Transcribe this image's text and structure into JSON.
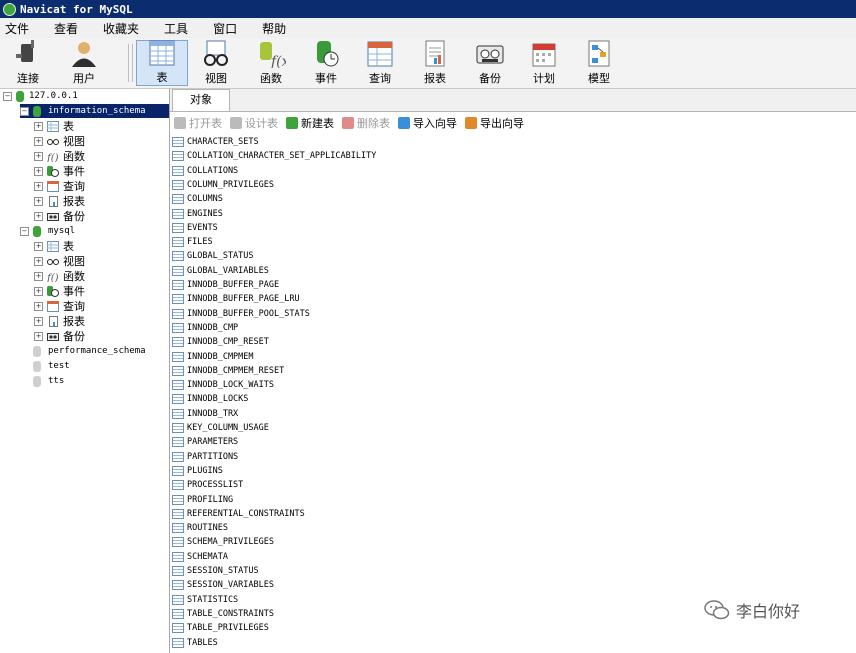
{
  "window": {
    "title": "Navicat for MySQL"
  },
  "menu": [
    "文件",
    "查看",
    "收藏夹",
    "工具",
    "窗口",
    "帮助"
  ],
  "toolbar": [
    {
      "label": "连接",
      "icon": "plug-icon"
    },
    {
      "label": "用户",
      "icon": "user-icon"
    },
    {
      "label": "表",
      "icon": "table-icon",
      "active": true
    },
    {
      "label": "视图",
      "icon": "glasses-icon"
    },
    {
      "label": "函数",
      "icon": "function-icon"
    },
    {
      "label": "事件",
      "icon": "event-clock-icon"
    },
    {
      "label": "查询",
      "icon": "query-icon"
    },
    {
      "label": "报表",
      "icon": "report-icon"
    },
    {
      "label": "备份",
      "icon": "backup-tape-icon"
    },
    {
      "label": "计划",
      "icon": "calendar-icon"
    },
    {
      "label": "模型",
      "icon": "model-icon"
    }
  ],
  "tree": {
    "connection": "127.0.0.1",
    "databases": [
      {
        "name": "information_schema",
        "selected": true,
        "expanded": true,
        "children": [
          "表",
          "视图",
          "函数",
          "事件",
          "查询",
          "报表",
          "备份"
        ]
      },
      {
        "name": "mysql",
        "expanded": true,
        "children": [
          "表",
          "视图",
          "函数",
          "事件",
          "查询",
          "报表",
          "备份"
        ]
      },
      {
        "name": "performance_schema"
      },
      {
        "name": "test"
      },
      {
        "name": "tts"
      }
    ]
  },
  "tabs": [
    "对象"
  ],
  "actions": [
    {
      "label": "打开表",
      "enabled": false,
      "color": "#bbbbbb"
    },
    {
      "label": "设计表",
      "enabled": false,
      "color": "#bbbbbb"
    },
    {
      "label": "新建表",
      "enabled": true,
      "color": "#3da33b"
    },
    {
      "label": "删除表",
      "enabled": false,
      "color": "#e08a8a"
    },
    {
      "label": "导入向导",
      "enabled": true,
      "color": "#3a8fd9"
    },
    {
      "label": "导出向导",
      "enabled": true,
      "color": "#e0892a"
    }
  ],
  "tables": [
    "CHARACTER_SETS",
    "COLLATION_CHARACTER_SET_APPLICABILITY",
    "COLLATIONS",
    "COLUMN_PRIVILEGES",
    "COLUMNS",
    "ENGINES",
    "EVENTS",
    "FILES",
    "GLOBAL_STATUS",
    "GLOBAL_VARIABLES",
    "INNODB_BUFFER_PAGE",
    "INNODB_BUFFER_PAGE_LRU",
    "INNODB_BUFFER_POOL_STATS",
    "INNODB_CMP",
    "INNODB_CMP_RESET",
    "INNODB_CMPMEM",
    "INNODB_CMPMEM_RESET",
    "INNODB_LOCK_WAITS",
    "INNODB_LOCKS",
    "INNODB_TRX",
    "KEY_COLUMN_USAGE",
    "PARAMETERS",
    "PARTITIONS",
    "PLUGINS",
    "PROCESSLIST",
    "PROFILING",
    "REFERENTIAL_CONSTRAINTS",
    "ROUTINES",
    "SCHEMA_PRIVILEGES",
    "SCHEMATA",
    "SESSION_STATUS",
    "SESSION_VARIABLES",
    "STATISTICS",
    "TABLE_CONSTRAINTS",
    "TABLE_PRIVILEGES",
    "TABLES"
  ],
  "watermark": "李白你好",
  "colors": {
    "titlebar": "#0b2c6e",
    "selection": "#0a246a",
    "accent_green": "#3da33b"
  }
}
